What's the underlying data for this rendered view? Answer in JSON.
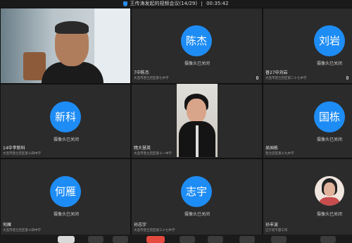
{
  "titlebar": {
    "title": "王传涛发起的视频会议(14/29)",
    "timer": "00:35:42"
  },
  "camera_off_text": "摄像头已关闭",
  "tiles": [
    {
      "name": "",
      "school": "",
      "avatar": ""
    },
    {
      "name": "7中陈杰",
      "school": "大连市普兰店区第七中学",
      "avatar": "陈杰"
    },
    {
      "name": "普27中刘岩",
      "school": "大连市普兰店区第二十七中学",
      "avatar": "刘岩"
    },
    {
      "name": "14中李新科",
      "school": "大连市普兰店区第十四中学",
      "avatar": "新科"
    },
    {
      "name": "隋大慧英",
      "school": "大连市普兰店区第十一中学",
      "avatar": ""
    },
    {
      "name": "吴国栋",
      "school": "普兰店区第十九中学",
      "avatar": "国栋"
    },
    {
      "name": "何雁",
      "school": "大连市普兰店区第十四中学",
      "avatar": "何雁"
    },
    {
      "name": "孙志宇",
      "school": "大连市普兰店区第三十七中学",
      "avatar": "志宇"
    },
    {
      "name": "孙丰波",
      "school": "辽宁老干部工作",
      "avatar": ""
    }
  ],
  "colors": {
    "avatar_blue": "#1e8cf5",
    "tile_bg": "#2b2b2b",
    "end_red": "#e44a3e"
  },
  "toolbar": {
    "icons": [
      "mic-icon",
      "camera-icon",
      "share-icon",
      "end-call-icon",
      "members-icon",
      "more-icon"
    ]
  }
}
